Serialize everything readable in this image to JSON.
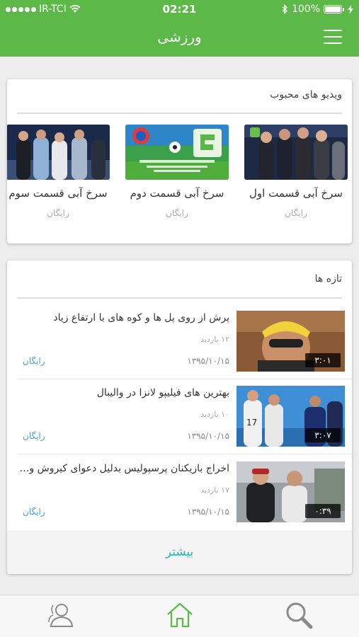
{
  "status_bar": {
    "carrier": "IR-TCI",
    "time": "02:21",
    "battery": "100%"
  },
  "header": {
    "title": "ورزشی"
  },
  "popular": {
    "title": "ویدیو های محبوب",
    "items": [
      {
        "label": "سرخ آبی قسمت اول",
        "price": "رایگان"
      },
      {
        "label": "سرخ آبی قسمت دوم",
        "price": "رایگان"
      },
      {
        "label": "سرخ آبی قسمت سوم",
        "price": "رایگان"
      }
    ]
  },
  "latest": {
    "title": "تازه ها",
    "items": [
      {
        "title": "پرش از روی پل ها و کوه های با ارتفاع زیاد",
        "views": "۱۲ بازدید",
        "date": "۱۳۹۵/۱۰/۱۵",
        "price": "رایگان",
        "duration": "۳:۰۱"
      },
      {
        "title": "بهترین های فیلیپو لانزا در والیبال",
        "views": "۱۰ بازدید",
        "date": "۱۳۹۵/۱۰/۱۵",
        "price": "رایگان",
        "duration": "۳:۰۷"
      },
      {
        "title": "اخراج بازیکنان پرسپولیس بدلیل دعوای کیروش و بر...",
        "views": "۱۷ بازدید",
        "date": "۱۳۹۵/۱۰/۱۵",
        "price": "رایگان",
        "duration": "۰:۳۹"
      }
    ],
    "more_label": "بیشتر"
  },
  "tabbar": {
    "icons": [
      "profile-icon",
      "home-icon",
      "search-icon"
    ],
    "active_color": "#5cb948",
    "inactive_color": "#8a8a8a"
  }
}
